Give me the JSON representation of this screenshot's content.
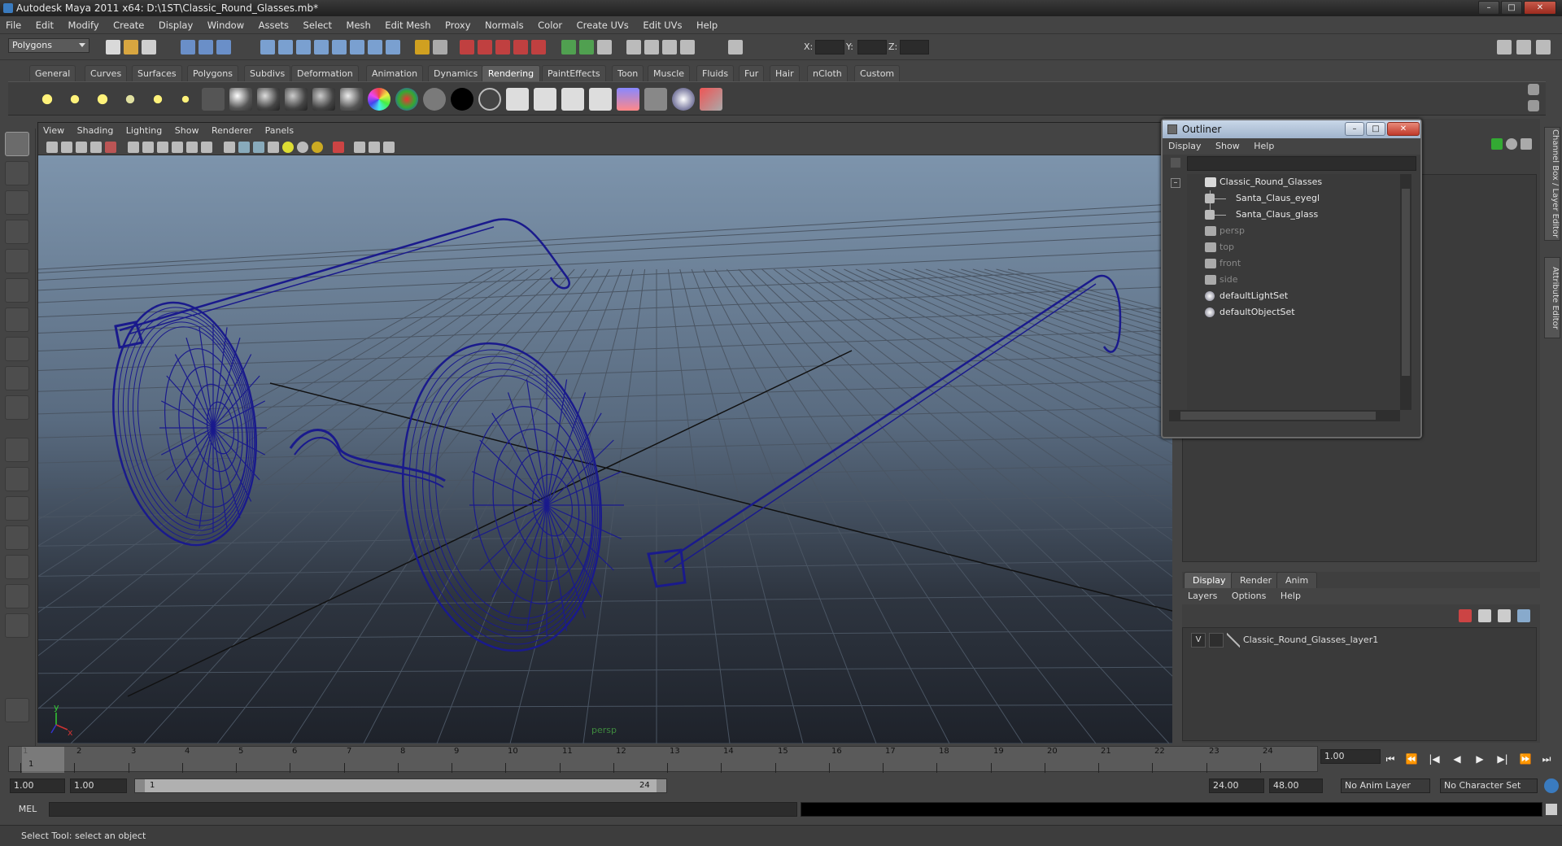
{
  "window": {
    "title": "Autodesk Maya 2011 x64: D:\\1ST\\Classic_Round_Glasses.mb*",
    "buttons": {
      "minimize": "–",
      "maximize": "□",
      "close": "✕"
    }
  },
  "menubar": [
    "File",
    "Edit",
    "Modify",
    "Create",
    "Display",
    "Window",
    "Assets",
    "Select",
    "Mesh",
    "Edit Mesh",
    "Proxy",
    "Normals",
    "Color",
    "Create UVs",
    "Edit UVs",
    "Help"
  ],
  "statusline": {
    "mode": "Polygons",
    "xyz_labels": [
      "X:",
      "Y:",
      "Z:"
    ]
  },
  "shelf": {
    "tabs": [
      "General",
      "Curves",
      "Surfaces",
      "Polygons",
      "Subdivs",
      "Deformation",
      "Animation",
      "Dynamics",
      "Rendering",
      "PaintEffects",
      "Toon",
      "Muscle",
      "Fluids",
      "Fur",
      "Hair",
      "nCloth",
      "Custom"
    ],
    "active_tab": "Rendering"
  },
  "viewport": {
    "menu": [
      "View",
      "Shading",
      "Lighting",
      "Show",
      "Renderer",
      "Panels"
    ],
    "camera_label": "persp",
    "axis": {
      "y": "y",
      "x": "x"
    }
  },
  "outliner": {
    "title": "Outliner",
    "menu": [
      "Display",
      "Show",
      "Help"
    ],
    "collapse_glyph": "–",
    "items": [
      {
        "label": "Classic_Round_Glasses",
        "indent": 0,
        "icon": "group-icon",
        "dim": false
      },
      {
        "label": "Santa_Claus_eyegl",
        "indent": 1,
        "icon": "mesh-icon",
        "dim": false
      },
      {
        "label": "Santa_Claus_glass",
        "indent": 1,
        "icon": "mesh-icon",
        "dim": false
      },
      {
        "label": "persp",
        "indent": 0,
        "icon": "camera-icon",
        "dim": true
      },
      {
        "label": "top",
        "indent": 0,
        "icon": "camera-icon",
        "dim": true
      },
      {
        "label": "front",
        "indent": 0,
        "icon": "camera-icon",
        "dim": true
      },
      {
        "label": "side",
        "indent": 0,
        "icon": "camera-icon",
        "dim": true
      },
      {
        "label": "defaultLightSet",
        "indent": 0,
        "icon": "set-icon",
        "dim": false
      },
      {
        "label": "defaultObjectSet",
        "indent": 0,
        "icon": "set-icon",
        "dim": false
      }
    ]
  },
  "side_tabs": [
    "Channel Box / Layer Editor",
    "Attribute Editor"
  ],
  "layer_editor": {
    "tabs": [
      "Display",
      "Render",
      "Anim"
    ],
    "active_tab": "Display",
    "menu": [
      "Layers",
      "Options",
      "Help"
    ],
    "layer": {
      "visibility": "V",
      "name": "Classic_Round_Glasses_layer1"
    }
  },
  "timeline": {
    "frames": [
      "1",
      "2",
      "3",
      "4",
      "5",
      "6",
      "7",
      "8",
      "9",
      "10",
      "11",
      "12",
      "13",
      "14",
      "15",
      "16",
      "17",
      "18",
      "19",
      "20",
      "21",
      "22",
      "23",
      "24"
    ],
    "current_frame": "1",
    "current_time_field": "1.00"
  },
  "range": {
    "start_time": "1.00",
    "playback_start": "1.00",
    "range_start_label": "1",
    "range_end_label": "24",
    "playback_end": "24.00",
    "end_time": "48.00",
    "anim_layer": "No Anim Layer",
    "character_set": "No Character Set"
  },
  "playback": {
    "go_start": "⏮",
    "step_back_key": "⏪",
    "step_back": "|◀",
    "play_back": "◀",
    "play_forward": "▶",
    "step_forward": "▶|",
    "step_forward_key": "⏩",
    "go_end": "⏭"
  },
  "cmdline": {
    "language": "MEL"
  },
  "helpline": {
    "text": "Select Tool: select an object"
  },
  "colors": {
    "wire": "#1a1a8c",
    "accent": "#9fb3cc",
    "grid": "#4a5563"
  }
}
